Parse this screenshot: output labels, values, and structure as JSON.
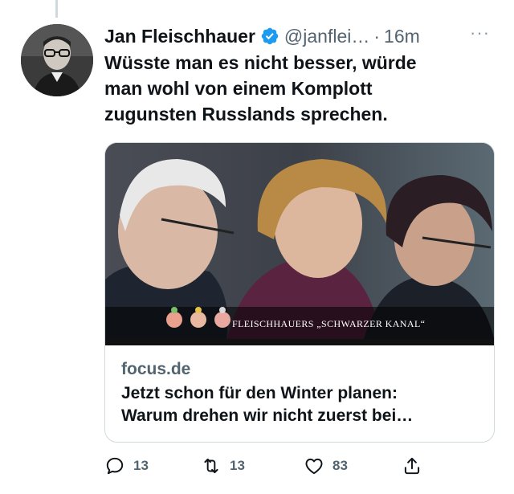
{
  "tweet": {
    "author_name": "Jan Fleischhauer",
    "handle": "@janflei…",
    "separator": "·",
    "time": "16m",
    "more_label": "···",
    "text_lines": [
      "Wüsste man es nicht besser, würde",
      "man wohl von einem Komplott",
      "zugunsten Russlands sprechen."
    ]
  },
  "card": {
    "image_caption": "FLEISCHHAUERS „SCHWARZER KANAL“",
    "domain": "focus.de",
    "title_lines": [
      "Jetzt schon für den Winter planen:",
      "Warum drehen wir nicht zuerst bei…"
    ]
  },
  "actions": {
    "replies": "13",
    "retweets": "13",
    "likes": "83"
  },
  "colors": {
    "text_primary": "#0f1419",
    "text_secondary": "#536471",
    "verified_blue": "#1d9bf0",
    "border": "#cfd9de"
  },
  "icons": [
    "verified-badge-icon",
    "more-icon",
    "reply-icon",
    "retweet-icon",
    "like-icon",
    "share-icon"
  ]
}
